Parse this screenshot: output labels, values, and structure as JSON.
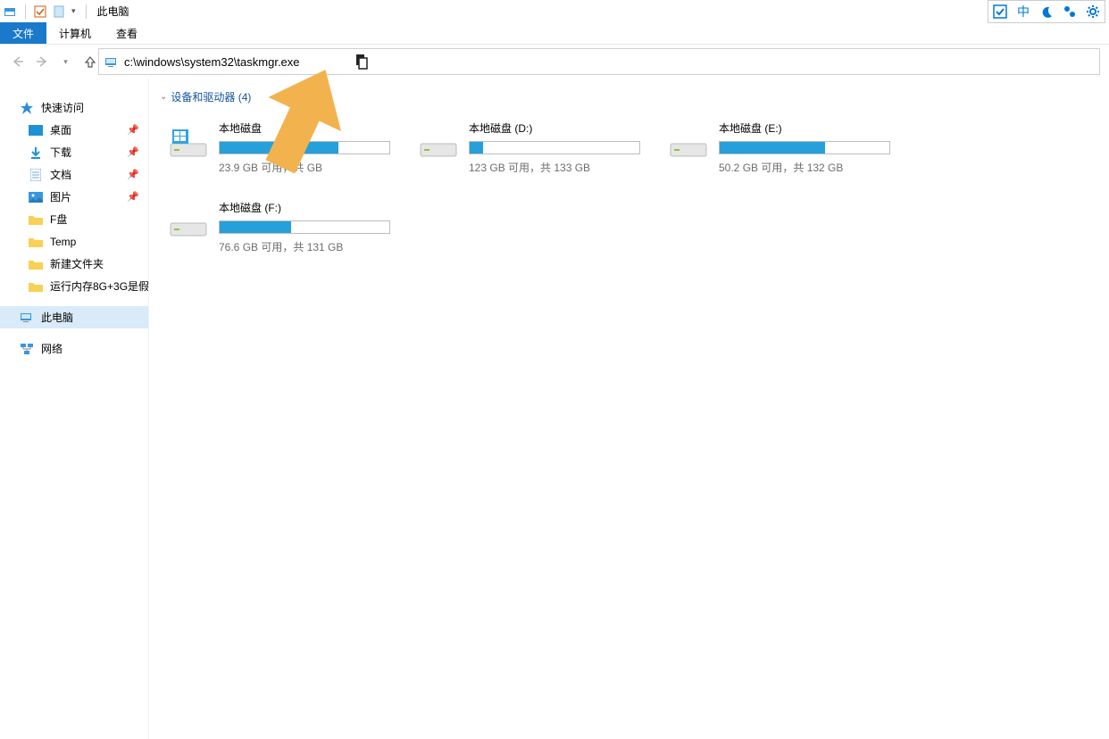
{
  "title": "此电脑",
  "ribbon_tabs": {
    "file": "文件",
    "computer": "计算机",
    "view": "查看"
  },
  "address": "c:\\windows\\system32\\taskmgr.exe",
  "ime_middle": "中",
  "sidebar": {
    "quick_access": "快速访问",
    "items": [
      {
        "label": "桌面",
        "pinned": true
      },
      {
        "label": "下载",
        "pinned": true
      },
      {
        "label": "文档",
        "pinned": true
      },
      {
        "label": "图片",
        "pinned": true
      },
      {
        "label": "F盘",
        "pinned": false
      },
      {
        "label": "Temp",
        "pinned": false
      },
      {
        "label": "新建文件夹",
        "pinned": false
      },
      {
        "label": "运行内存8G+3G是假",
        "pinned": false
      }
    ],
    "this_pc": "此电脑",
    "network": "网络"
  },
  "section": {
    "header": "设备和驱动器 (4)"
  },
  "drives": [
    {
      "name": "本地磁盘",
      "stats": "23.9 GB 可用，共 GB",
      "fill": 70,
      "os": true
    },
    {
      "name": "本地磁盘 (D:)",
      "stats": "123 GB 可用，共 133 GB",
      "fill": 8,
      "os": false
    },
    {
      "name": "本地磁盘 (E:)",
      "stats": "50.2 GB 可用，共 132 GB",
      "fill": 62,
      "os": false
    },
    {
      "name": "本地磁盘 (F:)",
      "stats": "76.6 GB 可用，共 131 GB",
      "fill": 42,
      "os": false
    }
  ]
}
